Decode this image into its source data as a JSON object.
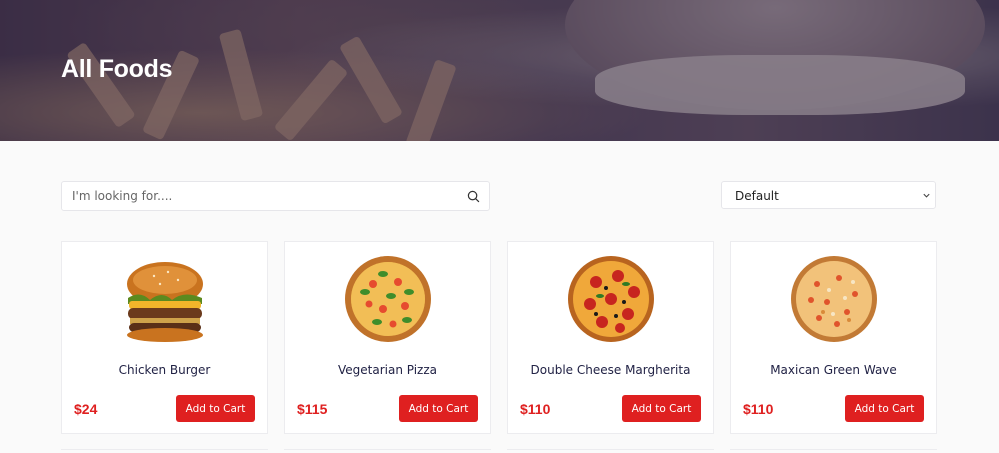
{
  "hero": {
    "title": "All Foods"
  },
  "search": {
    "placeholder": "I'm looking for...."
  },
  "sort": {
    "selected": "Default"
  },
  "products": [
    {
      "name": "Chicken Burger",
      "price": "$24",
      "button": "Add to Cart",
      "image": "burger"
    },
    {
      "name": "Vegetarian Pizza",
      "price": "$115",
      "button": "Add to Cart",
      "image": "veg-pizza"
    },
    {
      "name": "Double Cheese Margherita",
      "price": "$110",
      "button": "Add to Cart",
      "image": "pepperoni-pizza"
    },
    {
      "name": "Maxican Green Wave",
      "price": "$110",
      "button": "Add to Cart",
      "image": "green-wave-pizza"
    }
  ],
  "colors": {
    "accent": "#df2020",
    "heading": "#212245"
  }
}
